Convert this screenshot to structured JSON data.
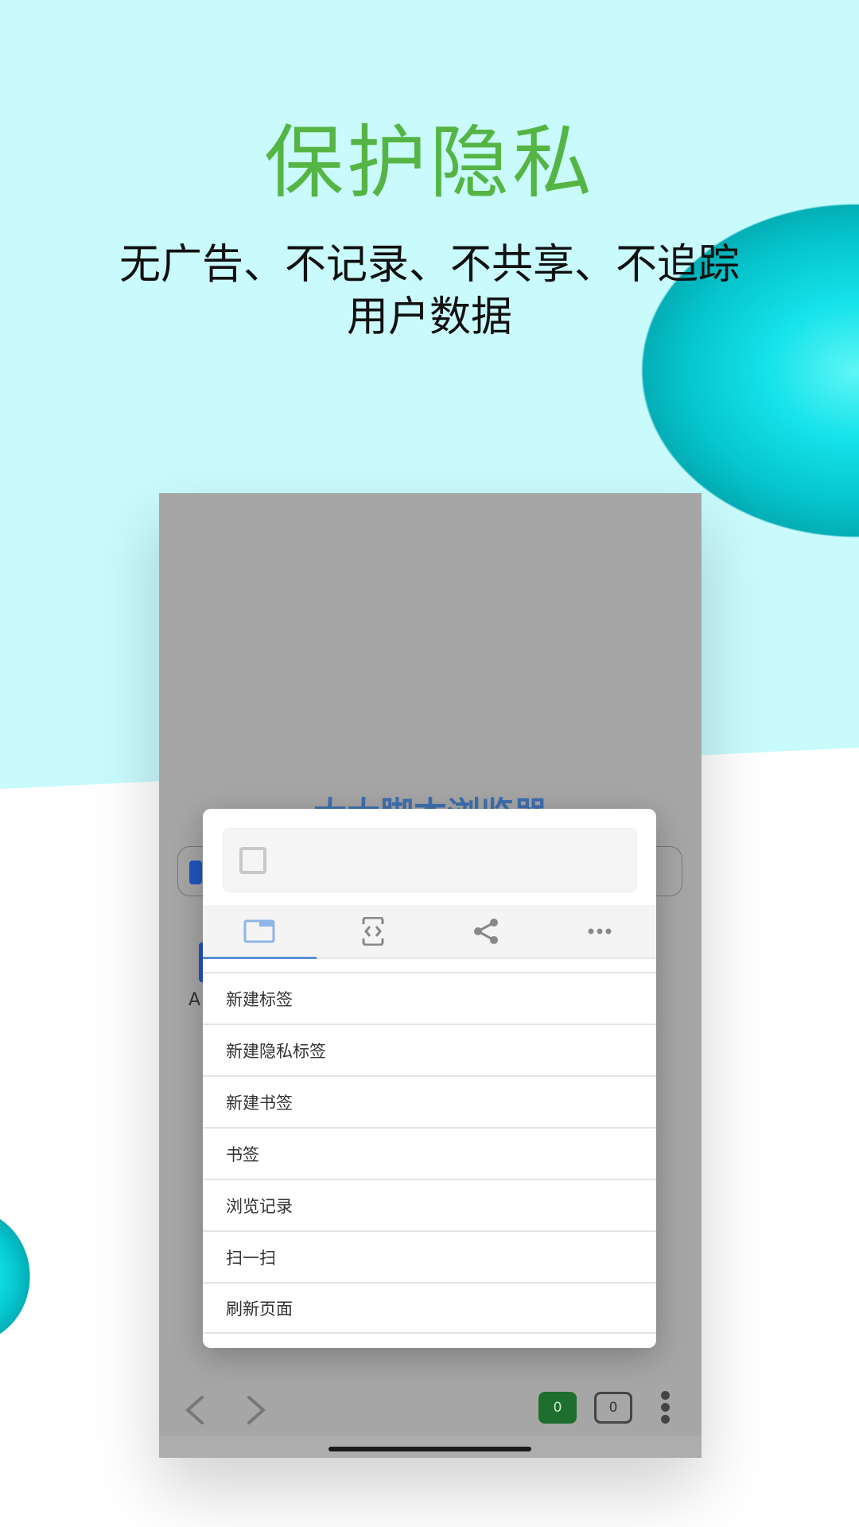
{
  "hero": {
    "title": "保护隐私",
    "subtitle_line1": "无广告、不记录、不共享、不追踪",
    "subtitle_line2": "用户数据"
  },
  "colors": {
    "title": "#55b544",
    "background": "#c9fafc",
    "accent": "#5a8fd6",
    "tab_badge": "#1e6e2d"
  },
  "background_app": {
    "title": "大大脚本浏览器",
    "shortcut_label": "A"
  },
  "menu": {
    "tabs": [
      {
        "icon": "window-icon",
        "active": true
      },
      {
        "icon": "code-icon"
      },
      {
        "icon": "share-icon"
      },
      {
        "icon": "more-horizontal-icon"
      }
    ],
    "items": [
      "新建标签",
      "新建隐私标签",
      "新建书签",
      "书签",
      "浏览记录",
      "扫一扫",
      "刷新页面"
    ]
  },
  "toolbar": {
    "tab_count": "0",
    "private_tab_count": "0"
  }
}
